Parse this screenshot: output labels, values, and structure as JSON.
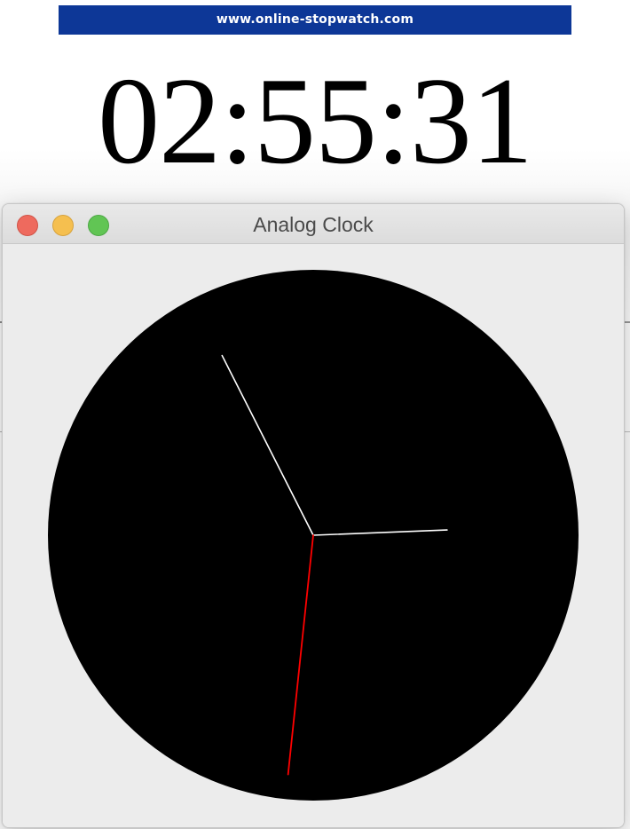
{
  "website": {
    "banner_text": "www.online-stopwatch.com",
    "banner_color": "#0d3797",
    "digital_time": "02:55:31"
  },
  "window": {
    "title": "Analog Clock",
    "controls": {
      "close_color": "#ee6a5e",
      "minimize_color": "#f5bf4f",
      "zoom_color": "#61c554"
    }
  },
  "clock": {
    "face_color": "#000000",
    "hand_color": "#ffffff",
    "second_hand_color": "#ff0000",
    "time": {
      "hours": 2,
      "minutes": 55,
      "seconds": 31
    }
  }
}
